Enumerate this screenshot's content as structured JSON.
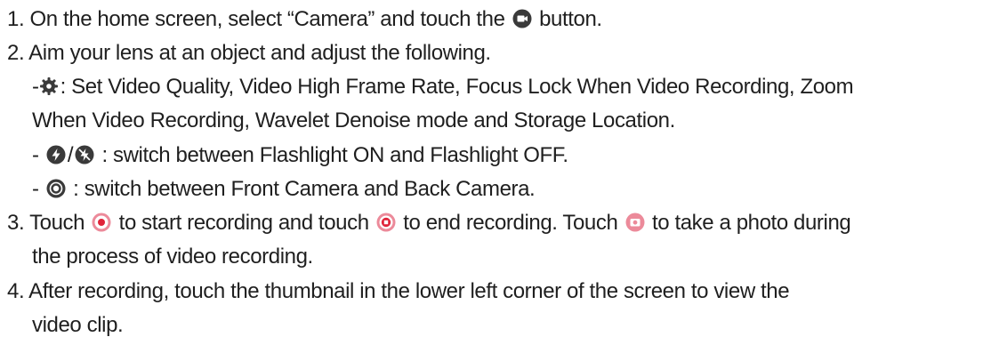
{
  "steps": [
    {
      "number": "1.",
      "before_icon": "On the home screen, select “Camera” and touch the",
      "icon": "video-mode-icon",
      "after_icon": "button."
    },
    {
      "number": "2.",
      "text": "Aim your lens at an object and adjust the following.",
      "subitems": [
        {
          "prefix": "-",
          "icon": "settings-gear-icon",
          "lines": [
            ": Set Video Quality, Video High Frame Rate, Focus Lock When Video Recording, Zoom",
            "When Video Recording, Wavelet Denoise mode and Storage Location."
          ]
        },
        {
          "prefix": "-",
          "icons": [
            "flash-on-icon",
            "flash-off-icon"
          ],
          "separator": "/",
          "text": ": switch between Flashlight ON and Flashlight OFF."
        },
        {
          "prefix": "-",
          "icon": "switch-camera-icon",
          "text": ": switch between Front Camera and Back Camera."
        }
      ]
    },
    {
      "number": "3.",
      "part1": "Touch",
      "icon1": "record-start-icon",
      "part2": "to start recording and touch",
      "icon2": "record-stop-icon",
      "part3": "to end recording. Touch",
      "icon3": "capture-photo-icon",
      "part4": "to take a photo during",
      "line2": "the process of video recording."
    },
    {
      "number": "4.",
      "line1": "After recording, touch the thumbnail in the lower left corner of the screen to view the",
      "line2": "video clip."
    }
  ],
  "colors": {
    "icon_dark": "#3a3a3a",
    "icon_red": "#e0243a",
    "icon_pink": "#ec8a9a",
    "text": "#1f1f1f"
  }
}
